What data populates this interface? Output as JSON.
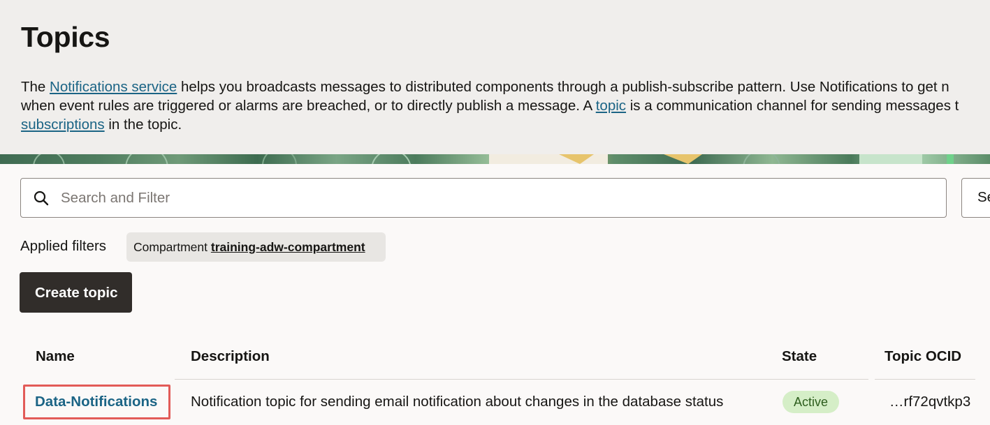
{
  "header": {
    "title": "Topics",
    "intro": {
      "line1_before": "The ",
      "notifications_link": "Notifications service",
      "line1_after": " helps you broadcasts messages to distributed components through a publish-subscribe pattern. Use Notifications to get n",
      "line2_before": "when event rules are triggered or alarms are breached, or to directly publish a message. A ",
      "topic_link": "topic",
      "line2_after": " is a communication channel for sending messages t",
      "subscriptions_link": "subscriptions",
      "line3_after": " in the topic."
    }
  },
  "search": {
    "placeholder": "Search and Filter",
    "icon": "search-icon",
    "side_button_label": "Se"
  },
  "filters": {
    "label": "Applied filters",
    "chip_prefix": "Compartment ",
    "chip_value": "training-adw-compartment"
  },
  "actions": {
    "create_label": "Create topic"
  },
  "table": {
    "columns": [
      "Name",
      "Description",
      "State",
      "Topic OCID"
    ],
    "rows": [
      {
        "name": "Data-Notifications",
        "description": "Notification topic for sending email notification about changes in the database status",
        "state": "Active",
        "ocid": "…rf72qvtkp3"
      }
    ]
  },
  "colors": {
    "link": "#1b6485",
    "primary_button": "#312d2a",
    "active_badge_bg": "#d5eec7",
    "highlight": "#e25b58"
  }
}
